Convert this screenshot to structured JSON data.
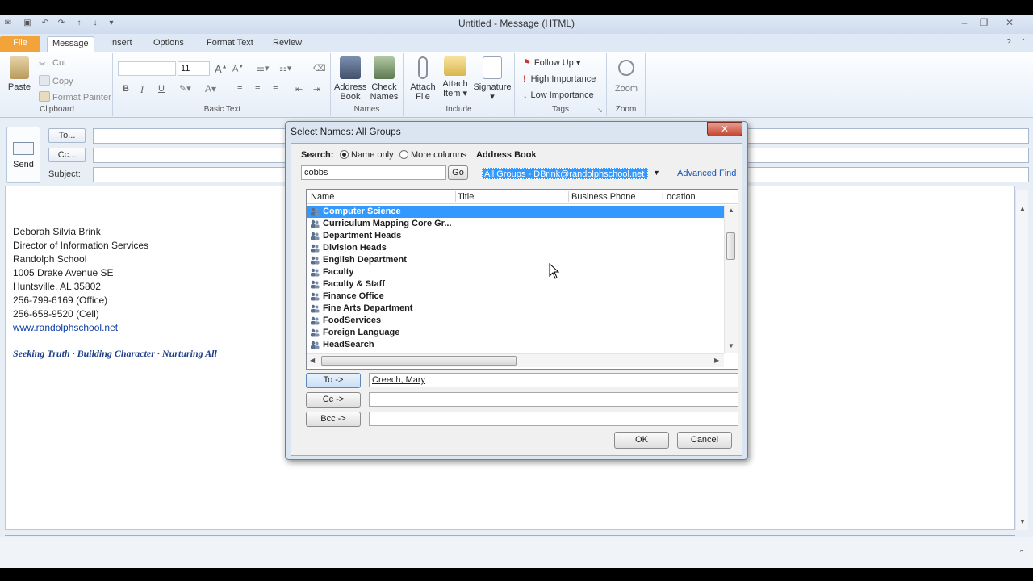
{
  "window": {
    "title": "Untitled - Message (HTML)"
  },
  "tabs": [
    {
      "label": "File"
    },
    {
      "label": "Message"
    },
    {
      "label": "Insert"
    },
    {
      "label": "Options"
    },
    {
      "label": "Format Text"
    },
    {
      "label": "Review"
    }
  ],
  "ribbon": {
    "clipboard": {
      "label": "Clipboard",
      "paste": "Paste",
      "cut": "Cut",
      "copy": "Copy",
      "format_painter": "Format Painter"
    },
    "basic_text": {
      "label": "Basic Text",
      "font_size": "11",
      "bold": "B",
      "italic": "I",
      "underline": "U"
    },
    "names": {
      "label": "Names",
      "address_book": [
        "Address",
        "Book"
      ],
      "check_names": [
        "Check",
        "Names"
      ]
    },
    "include": {
      "label": "Include",
      "attach_file": [
        "Attach",
        "File"
      ],
      "attach_item": [
        "Attach",
        "Item"
      ],
      "signature": "Signature"
    },
    "tags": {
      "label": "Tags",
      "follow_up": "Follow Up",
      "high_importance": "High Importance",
      "low_importance": "Low Importance"
    },
    "zoom": {
      "label": "Zoom",
      "zoom_button": "Zoom"
    }
  },
  "compose": {
    "send": "Send",
    "to_button": "To...",
    "cc_button": "Cc...",
    "subject_label": "Subject:",
    "signature_lines": [
      "Deborah Silvia Brink",
      "Director of Information Services",
      "Randolph School",
      "1005 Drake Avenue SE",
      "Huntsville, AL 35802",
      "256-799-6169 (Office)",
      "256-658-9520 (Cell)"
    ],
    "website": "www.randolphschool.net",
    "motto": "Seeking Truth · Building Character · Nurturing All"
  },
  "dialog": {
    "title": "Select Names: All Groups",
    "close": "✕",
    "search_label": "Search:",
    "name_only": "Name only",
    "more_columns": "More columns",
    "address_book_label": "Address Book",
    "search_value": "cobbs",
    "go": "Go",
    "address_book_value": "All Groups - DBrink@randolphschool.net",
    "advanced_find": "Advanced Find",
    "columns": [
      "Name",
      "Title",
      "Business Phone",
      "Location"
    ],
    "rows": [
      "Computer Science",
      "Curriculum Mapping Core Gr...",
      "Department Heads",
      "Division Heads",
      "English Department",
      "Faculty",
      "Faculty & Staff",
      "Finance Office",
      "Fine Arts Department",
      "FoodServices",
      "Foreign Language",
      "HeadSearch"
    ],
    "selected_row": "Computer Science",
    "to_button": "To ->",
    "cc_button": "Cc ->",
    "bcc_button": "Bcc ->",
    "to_value": "Creech, Mary",
    "cc_value": "",
    "bcc_value": "",
    "ok": "OK",
    "cancel": "Cancel"
  },
  "colors": {
    "file_tab": "#f2a33a",
    "selection": "#3399ff",
    "link": "#0b3ea6",
    "motto": "#1f3f8a"
  }
}
